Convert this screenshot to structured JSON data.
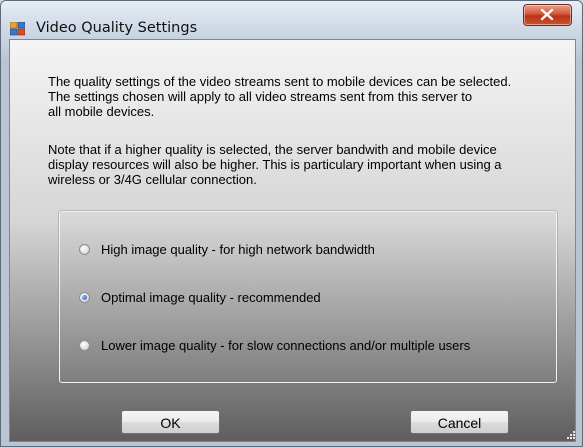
{
  "window": {
    "title": "Video Quality Settings",
    "close_icon": "close-icon"
  },
  "content": {
    "paragraph1": "The quality settings of the video streams sent to mobile devices can be selected.\nThe settings chosen will apply to all video streams sent from this server to\nall mobile devices.",
    "paragraph2": "Note that if a higher quality is selected, the server bandwith and mobile device\ndisplay resources will also be higher. This is particulary important when using a\nwireless or 3/4G cellular connection."
  },
  "options": [
    {
      "label": "High image quality - for high network bandwidth",
      "checked": false
    },
    {
      "label": "Optimal image quality - recommended",
      "checked": true
    },
    {
      "label": "Lower image quality - for slow connections and/or multiple users",
      "checked": false
    }
  ],
  "buttons": {
    "ok": "OK",
    "cancel": "Cancel"
  },
  "colors": {
    "close_button": "#c8432a",
    "selected_radio": "#1f4fb8"
  }
}
